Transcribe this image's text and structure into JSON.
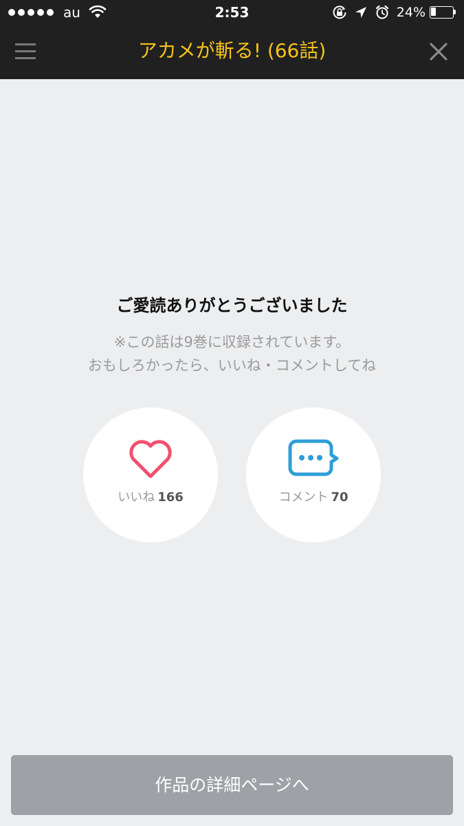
{
  "status_bar": {
    "carrier": "au",
    "time": "2:53",
    "battery_percent": "24%",
    "battery_level": 0.24,
    "signal_bars": 5,
    "icons": [
      "signal-icon",
      "wifi-icon",
      "rotation-lock-icon",
      "location-arrow-icon",
      "alarm-icon",
      "battery-icon"
    ]
  },
  "header": {
    "title": "アカメが斬る! (66話)",
    "title_color": "#f6c31a",
    "menu_icon": "hamburger-menu-icon",
    "close_icon": "close-icon"
  },
  "message": {
    "title": "ご愛読ありがとうございました",
    "line1": "※この話は9巻に収録されています。",
    "line2": "おもしろかったら、いいね・コメントしてね"
  },
  "actions": {
    "like": {
      "icon": "heart-icon",
      "label": "いいね",
      "count": "166",
      "color": "#f0506e"
    },
    "comment": {
      "icon": "speech-bubble-icon",
      "label": "コメント",
      "count": "70",
      "color": "#2e9fd6"
    }
  },
  "footer": {
    "detail_button_label": "作品の詳細ページへ"
  }
}
